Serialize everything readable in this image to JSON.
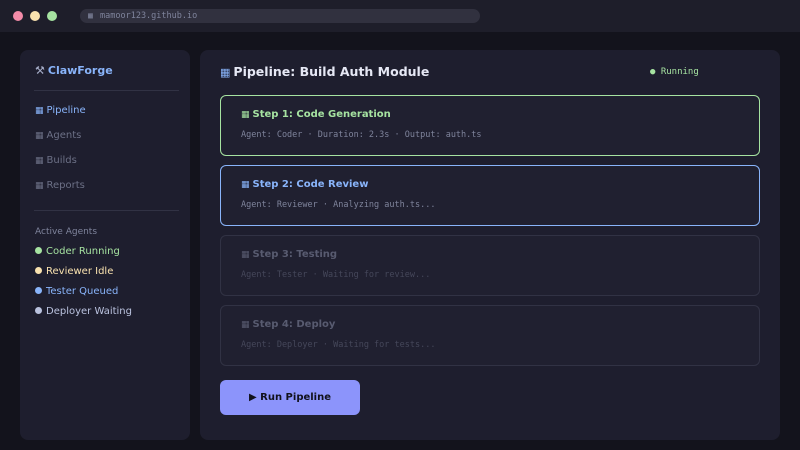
{
  "window": {
    "url": "mamoor123.github.io"
  },
  "sidebar": {
    "brand": "ClawForge",
    "brand_icon": "⚒",
    "nav": [
      {
        "icon": "▦",
        "label": "Pipeline",
        "active": true
      },
      {
        "icon": "▦",
        "label": "Agents",
        "active": false
      },
      {
        "icon": "▦",
        "label": "Builds",
        "active": false
      },
      {
        "icon": "▦",
        "label": "Reports",
        "active": false
      }
    ],
    "agents_heading": "Active Agents",
    "agents": [
      {
        "label": "Coder Running",
        "color": "#a6e3a1"
      },
      {
        "label": "Reviewer Idle",
        "color": "#f9e2af"
      },
      {
        "label": "Tester Queued",
        "color": "#89b4fa"
      },
      {
        "label": "Deployer Waiting",
        "color": "#bac2de"
      }
    ]
  },
  "main": {
    "title": "Pipeline: Build Auth Module",
    "title_icon": "▦",
    "status": "● Running",
    "steps": [
      {
        "title": "Step 1: Code Generation",
        "sub": "Agent: Coder · Duration: 2.3s · Output: auth.ts",
        "state": "done"
      },
      {
        "title": "Step 2: Code Review",
        "sub": "Agent: Reviewer · Analyzing auth.ts...",
        "state": "active"
      },
      {
        "title": "Step 3: Testing",
        "sub": "Agent: Tester · Waiting for review...",
        "state": "pending"
      },
      {
        "title": "Step 4: Deploy",
        "sub": "Agent: Deployer · Waiting for tests...",
        "state": "pending"
      }
    ],
    "run_button": "▶ Run Pipeline"
  },
  "colors": {
    "accent": "#89b4fa",
    "success": "#a6e3a1",
    "button": "#8c94fb"
  }
}
